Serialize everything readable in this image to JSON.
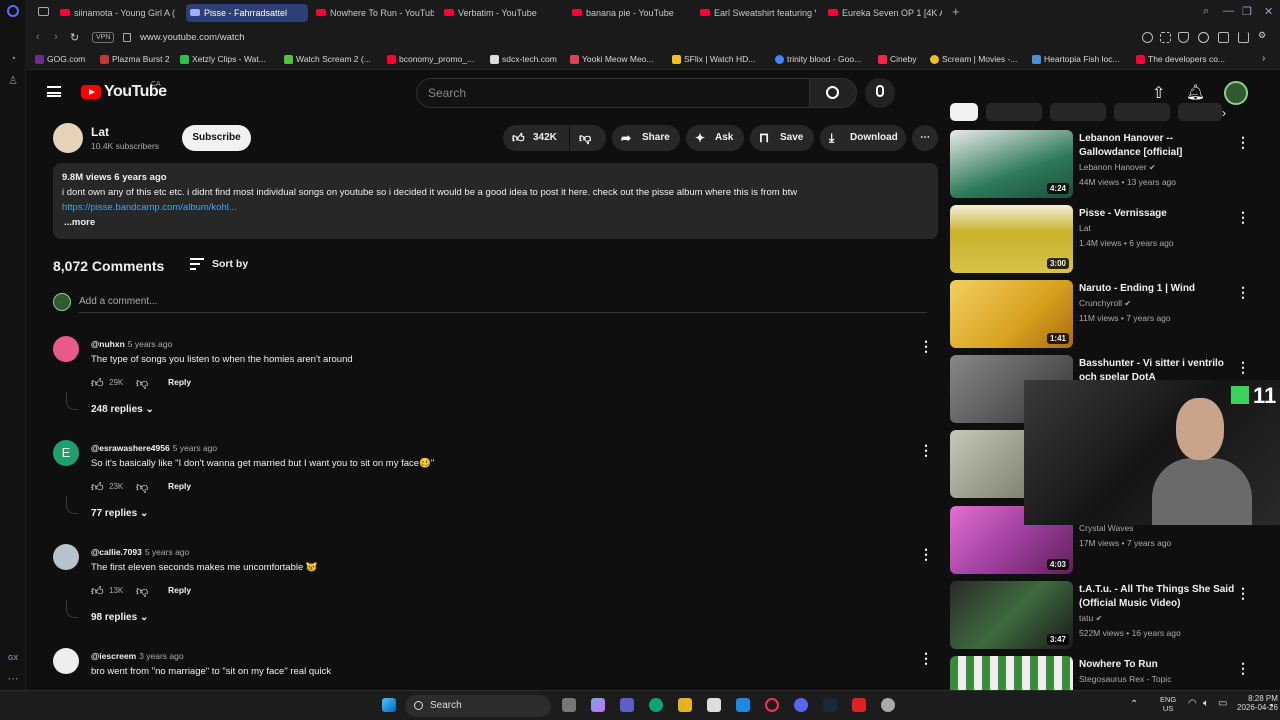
{
  "browser": {
    "tabs": [
      {
        "label": "siinamota - Young Girl A (",
        "active": false
      },
      {
        "label": "Pisse - Fahrradsattel",
        "active": true
      },
      {
        "label": "Nowhere To Run - YouTub",
        "active": false
      },
      {
        "label": "Verbatim - YouTube",
        "active": false
      },
      {
        "label": "banana pie - YouTube",
        "active": false
      },
      {
        "label": "Earl Sweatshirt featuring V",
        "active": false
      },
      {
        "label": "Eureka Seven OP 1 [4K AI U",
        "active": false
      }
    ],
    "new_tab": "+",
    "vpn_label": "VPN",
    "url": "www.youtube.com/watch",
    "bookmarks": [
      "GOG.com",
      "Plazma Burst 2",
      "Xetzly Clips - Wat...",
      "Watch Scream 2 (...",
      "bconomy_promo_...",
      "sdcx-tech.com",
      "Yooki Meow Meo...",
      "SFlix | Watch HD...",
      "trinity blood - Goo...",
      "Cineby",
      "Scream | Movies -...",
      "Heartopia Fish loc...",
      "The developers co..."
    ]
  },
  "youtube": {
    "logo_text": "YouTube",
    "region": "CA",
    "search_placeholder": "Search"
  },
  "video": {
    "channel": "Lat",
    "subscribers": "10.4K subscribers",
    "subscribe_label": "Subscribe",
    "likes": "342K",
    "share_label": "Share",
    "ask_label": "Ask",
    "save_label": "Save",
    "download_label": "Download",
    "views_age": "9.8M views  6 years ago",
    "description": "i dont own any of this etc etc. i didnt find most individual songs on youtube so i decided it would be a good idea to post it here. check out the pisse album where this is from btw",
    "link": "https://pisse.bandcamp.com/album/kohl...",
    "more": "...more"
  },
  "comments": {
    "count": "8,072 Comments",
    "sort_label": "Sort by",
    "add_placeholder": "Add a comment...",
    "items": [
      {
        "author": "@nuhxn",
        "age": "5 years ago",
        "text": "The type of songs you listen to when the homies aren't around",
        "likes": "29K",
        "reply": "Reply",
        "replies": "248 replies",
        "avatar_color": "#e85a8a"
      },
      {
        "author": "@esrawashere4956",
        "age": "5 years ago",
        "text": "So it's basically like \"I don't wanna get married but I want you to sit on my face🥴\"",
        "likes": "23K",
        "reply": "Reply",
        "replies": "77 replies",
        "avatar_color": "#1f9e6e",
        "avatar_letter": "E"
      },
      {
        "author": "@callie.7093",
        "age": "5 years ago",
        "text": "The first eleven seconds makes me uncomfortable 😿",
        "likes": "13K",
        "reply": "Reply",
        "replies": "98 replies",
        "avatar_color": "#b7c2cc"
      },
      {
        "author": "@iescreem",
        "age": "3 years ago",
        "text": "bro went from \"no marriage\" to \"sit on my face\" real quick",
        "likes": "",
        "reply": "",
        "replies": "",
        "avatar_color": "#eeeeee"
      }
    ]
  },
  "recommended": [
    {
      "title": "Lebanon Hanover -- Gallowdance [official]",
      "channel": "Lebanon Hanover",
      "verified": true,
      "meta": "44M views • 13 years ago",
      "duration": "4:24",
      "thumb": "#2e7a5a"
    },
    {
      "title": "Pisse - Vernissage",
      "channel": "Lat",
      "verified": false,
      "meta": "1.4M views • 6 years ago",
      "duration": "3:00",
      "thumb": "#c8b22a"
    },
    {
      "title": "Naruto - Ending 1 | Wind",
      "channel": "Crunchyroll",
      "verified": true,
      "meta": "11M views • 7 years ago",
      "duration": "1:41",
      "thumb": "#d8a11e"
    },
    {
      "title": "Basshunter - Vi sitter i ventrilo och spelar DotA",
      "channel": "",
      "verified": false,
      "meta": "",
      "duration": "",
      "thumb": "#5a5a5a"
    },
    {
      "title": "",
      "channel": "",
      "verified": false,
      "meta": "",
      "duration": "",
      "thumb": "#9a9a88"
    },
    {
      "title": "",
      "channel": "Crystal Waves",
      "verified": false,
      "meta": "17M views • 7 years ago",
      "duration": "4:03",
      "thumb": "#c050b8"
    },
    {
      "title": "t.A.T.u. - All The Things She Said (Official Music Video)",
      "channel": "tatu",
      "verified": true,
      "meta": "522M views • 16 years ago",
      "duration": "3:47",
      "thumb": "#3e6a3e"
    },
    {
      "title": "Nowhere To Run",
      "channel": "Stegosaurus Rex - Topic",
      "verified": false,
      "meta": "",
      "duration": "",
      "thumb": "#3a8a3a"
    }
  ],
  "webcam": {
    "overlay_text": "11"
  },
  "taskbar": {
    "search_label": "Search",
    "lang": "ENG",
    "region": "US",
    "time": "8:28 PM",
    "date": "2026-04-26"
  },
  "sidebar_gx": "GX"
}
